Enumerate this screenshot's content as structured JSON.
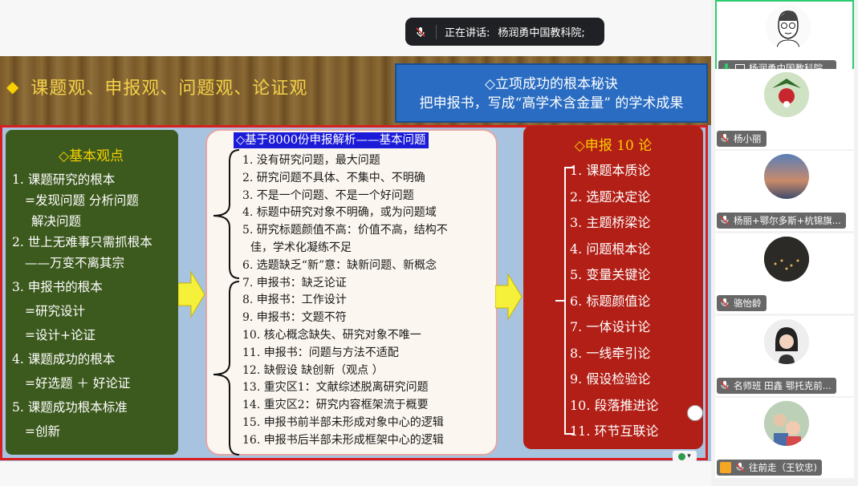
{
  "speaking": {
    "prefix": "正在讲话:",
    "name": "杨润勇中国教科院;"
  },
  "slide": {
    "title_diamond": "◆",
    "title": "课题观、申报观、问题观、论证观",
    "blue_box": {
      "line1": "◇立项成功的根本秘诀",
      "line2": "把申报书，写成“高学术含金量” 的学术成果"
    },
    "left_panel": {
      "heading": "◇基本观点",
      "lines": [
        "1. 课题研究的根本",
        "=发现问题  分析问题",
        "解决问题",
        "2. 世上无难事只需抓根本",
        "——万变不离其宗",
        "3. 申报书的根本",
        "=研究设计",
        "=设计+论证",
        "4. 课题成功的根本",
        "=好选题 ＋ 好论证",
        "5. 课题成功根本标准",
        "=创新"
      ]
    },
    "middle_panel": {
      "heading": "◇基于8000份申报解析——基本问题",
      "items": [
        "1. 没有研究问题，最大问题",
        "2. 研究问题不具体、不集中、不明确",
        "3. 不是一个问题、不是一个好问题",
        "4. 标题中研究对象不明确，或为问题域",
        "5. 研究标题颜值不高：价值不高，结构不",
        "佳，学术化凝练不足",
        "6. 选题缺乏“新”意：缺新问题、新概念",
        "7. 申报书：缺乏论证",
        "8. 申报书：工作设计",
        "9. 申报书：文题不符",
        "10. 核心概念缺失、研究对象不唯一",
        "11. 申报书：问题与方法不适配",
        "12. 缺假设  缺创新（观点 ）",
        "13. 重灾区1：文献综述脱离研究问题",
        "14. 重灾区2：研究内容框架流于概要",
        "15. 申报书前半部未形成对象中心的逻辑",
        "16. 申报书后半部未形成框架中心的逻辑"
      ]
    },
    "right_panel": {
      "heading": "◇申报 10 论",
      "items": [
        "1. 课题本质论",
        "2. 选题决定论",
        "3. 主题桥梁论",
        "4. 问题根本论",
        "5. 变量关键论",
        "6. 标题颜值论",
        "7. 一体设计论",
        "8. 一线牵引论",
        "9. 假设检验论",
        "10. 段落推进论",
        "11. 环节互联论"
      ]
    }
  },
  "participants": [
    {
      "name": "杨润勇中国教科院...",
      "active": true,
      "icon": "mic-on-icon"
    },
    {
      "name": "杨小丽",
      "active": false,
      "icon": "mic-off-icon"
    },
    {
      "name": "杨丽+鄂尔多斯+杭锦旗...",
      "active": false,
      "icon": "mic-off-icon"
    },
    {
      "name": "骆怡龄",
      "active": false,
      "icon": "mic-off-icon"
    },
    {
      "name": "名师班 田鑫 鄂托克前...",
      "active": false,
      "icon": "mic-off-icon"
    },
    {
      "name": "往前走（王钦忠)",
      "active": false,
      "icon": "mic-off-icon"
    }
  ],
  "colors": {
    "accent_green": "#2ecc71",
    "slide_red": "#d81e1e",
    "slide_yellow": "#f8d000",
    "blue_box": "#2a6cc1"
  }
}
